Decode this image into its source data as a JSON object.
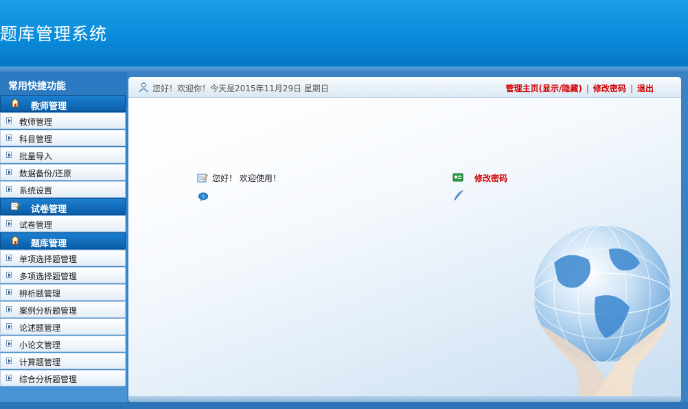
{
  "app": {
    "title": "题库管理系统"
  },
  "sidebar": {
    "title": "常用快捷功能",
    "groups": [
      {
        "label": "教师管理",
        "icon": "house-icon",
        "items": [
          "教师管理",
          "科目管理",
          "批量导入",
          "数据备份/还原",
          "系统设置"
        ]
      },
      {
        "label": "试卷管理",
        "icon": "edit-paper-icon",
        "items": [
          "试卷管理"
        ]
      },
      {
        "label": "题库管理",
        "icon": "house-icon",
        "items": [
          "单项选择题管理",
          "多项选择题管理",
          "辨析题管理",
          "案例分析题管理",
          "论述题管理",
          "小论文管理",
          "计算题管理",
          "综合分析题管理"
        ]
      }
    ]
  },
  "topbar": {
    "greeting": "您好！欢迎你！今天是2015年11月29日  星期日",
    "links": {
      "home": "管理主页(显示/隐藏)",
      "change_password": "修改密码",
      "logout": "退出"
    },
    "separator": "|"
  },
  "main": {
    "welcome": "您好！ 欢迎使用！",
    "change_password_link": "修改密码"
  },
  "colors": {
    "header": "#0a8ddc",
    "link_red": "#d00000",
    "sidebar": "#2a78bf"
  }
}
